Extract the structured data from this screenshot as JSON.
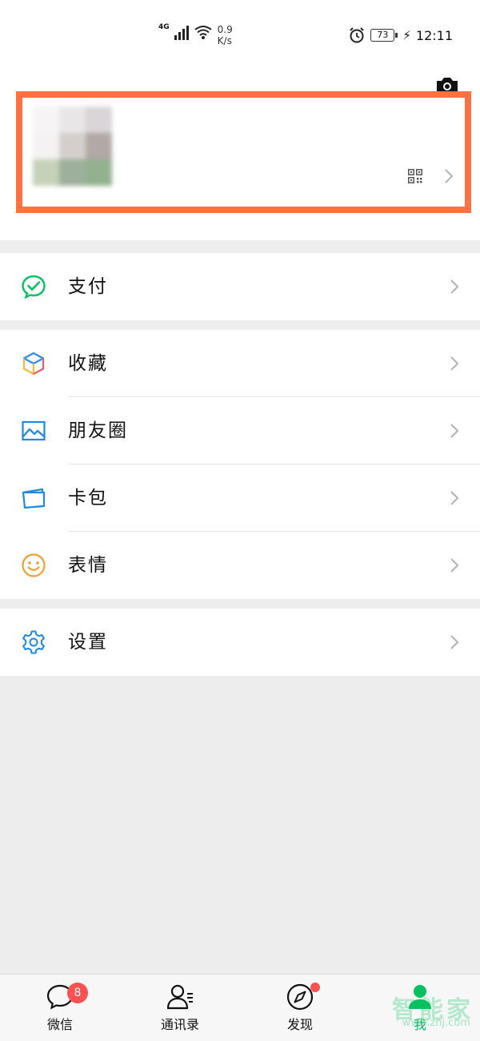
{
  "status_bar": {
    "network": "4G",
    "speed_value": "0.9",
    "speed_unit": "K/s",
    "battery": "73",
    "time": "12:11"
  },
  "profile": {
    "camera_icon": "camera-icon",
    "qr_icon": "qr-code-icon",
    "highlight_color": "#ff7043"
  },
  "menu": {
    "pay": {
      "label": "支付",
      "icon": "pay-check-icon",
      "color": "#07c160"
    },
    "favorites": {
      "label": "收藏",
      "icon": "cube-icon"
    },
    "moments": {
      "label": "朋友圈",
      "icon": "image-icon",
      "color": "#1e88e5"
    },
    "cards": {
      "label": "卡包",
      "icon": "card-wallet-icon",
      "color": "#1e88e5"
    },
    "stickers": {
      "label": "表情",
      "icon": "smiley-icon",
      "color": "#f0a030"
    },
    "settings": {
      "label": "设置",
      "icon": "gear-icon",
      "color": "#1e88e5"
    }
  },
  "tabbar": {
    "tabs": [
      {
        "label": "微信",
        "icon": "chat-bubble-icon",
        "badge": "8"
      },
      {
        "label": "通讯录",
        "icon": "contacts-icon"
      },
      {
        "label": "发现",
        "icon": "compass-icon",
        "dot": true
      },
      {
        "label": "我",
        "icon": "person-icon",
        "active": true
      }
    ],
    "active_color": "#07c160"
  },
  "watermark": {
    "text": "智能家",
    "sub": "www.znj.com"
  }
}
